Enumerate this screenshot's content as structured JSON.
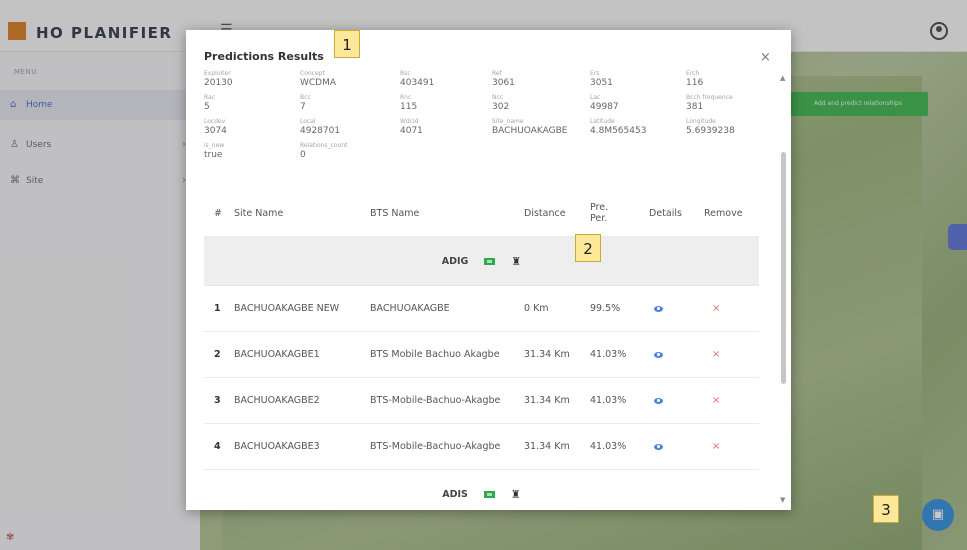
{
  "app": {
    "logo_text": "HO PLANIFIER",
    "accent": "#4a64c4",
    "brand_color": "#d87a1e"
  },
  "sidebar": {
    "caption": "MENU",
    "items": [
      {
        "label": "Home",
        "icon": "home-icon"
      },
      {
        "label": "Users",
        "icon": "user-icon"
      },
      {
        "label": "Site",
        "icon": "sitemap-icon"
      }
    ]
  },
  "map": {
    "action_button": "Add and predict relationships"
  },
  "modal": {
    "title": "Predictions Results",
    "close_glyph": "×",
    "params": [
      {
        "key": "Exploiter",
        "value": "20130"
      },
      {
        "key": "Concept",
        "value": "WCDMA"
      },
      {
        "key": "Bsc",
        "value": "403491"
      },
      {
        "key": "Ref",
        "value": "3061"
      },
      {
        "key": "Ers",
        "value": "3051"
      },
      {
        "key": "Erch",
        "value": "116"
      },
      {
        "key": "Rac",
        "value": "5"
      },
      {
        "key": "Bcc",
        "value": "7"
      },
      {
        "key": "Rnc",
        "value": "115"
      },
      {
        "key": "Ncc",
        "value": "302"
      },
      {
        "key": "Lac",
        "value": "49987"
      },
      {
        "key": "Bcch frequence",
        "value": "381"
      },
      {
        "key": "Locdev",
        "value": "3074"
      },
      {
        "key": "Local",
        "value": "4928701"
      },
      {
        "key": "Wdcid",
        "value": "4071"
      },
      {
        "key": "Site_name",
        "value": "BACHUOAKAGBE"
      },
      {
        "key": "Latitude",
        "value": "4.8M565453"
      },
      {
        "key": "Longitude",
        "value": "5.6939238"
      },
      {
        "key": "is_new",
        "value": "true"
      },
      {
        "key": "Relations_count",
        "value": "0"
      }
    ],
    "table": {
      "headers": {
        "index": "#",
        "site_name": "Site Name",
        "bts_name": "BTS Name",
        "distance": "Distance",
        "pre_per": "Pre. Per.",
        "details": "Details",
        "remove": "Remove"
      },
      "groups": [
        {
          "label": "ADIG"
        },
        {
          "label": "ADIS"
        }
      ],
      "rows": [
        {
          "index": "1",
          "site_name": "BACHUOAKAGBE NEW",
          "bts_name": "BACHUOAKAGBE",
          "distance": "0 Km",
          "pre_per": "99.5%"
        },
        {
          "index": "2",
          "site_name": "BACHUOAKAGBE1",
          "bts_name": "BTS Mobile Bachuo Akagbe",
          "distance": "31.34 Km",
          "pre_per": "41.03%"
        },
        {
          "index": "3",
          "site_name": "BACHUOAKAGBE2",
          "bts_name": "BTS-Mobile-Bachuo-Akagbe",
          "distance": "31.34 Km",
          "pre_per": "41.03%"
        },
        {
          "index": "4",
          "site_name": "BACHUOAKAGBE3",
          "bts_name": "BTS-Mobile-Bachuo-Akagbe",
          "distance": "31.34 Km",
          "pre_per": "41.03%"
        }
      ],
      "remove_glyph": "×",
      "remove_color": "#e36a6a",
      "details_color": "#4a86d8"
    }
  },
  "callouts": [
    "1",
    "2",
    "3"
  ]
}
